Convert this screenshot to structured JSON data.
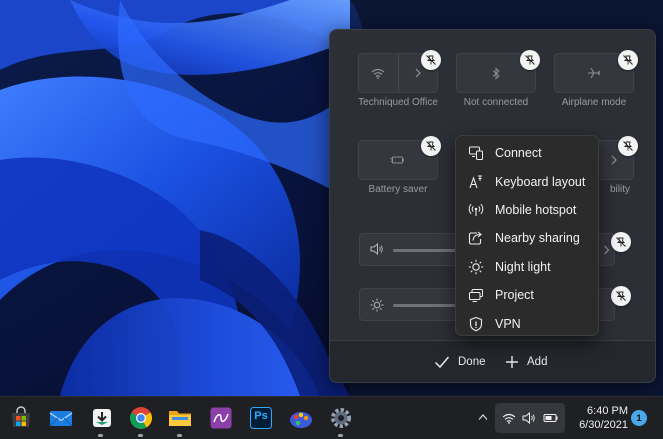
{
  "quick_settings": {
    "tiles": [
      {
        "label": "Techniqued Office",
        "icon": "wifi-icon",
        "split": true
      },
      {
        "label": "Not connected",
        "icon": "bluetooth-icon",
        "split": false
      },
      {
        "label": "Airplane mode",
        "icon": "airplane-icon",
        "split": false
      },
      {
        "label": "Battery saver",
        "icon": "battery-saver-icon",
        "split": false
      },
      {
        "label": "bility",
        "icon": "accessibility-icon",
        "split": true
      }
    ],
    "sliders": [
      {
        "icon": "volume-icon"
      },
      {
        "icon": "brightness-icon"
      }
    ],
    "footer": {
      "done_label": "Done",
      "add_label": "Add"
    }
  },
  "add_menu": {
    "items": [
      {
        "label": "Connect",
        "icon": "connect-icon"
      },
      {
        "label": "Keyboard layout",
        "icon": "keyboard-layout-icon"
      },
      {
        "label": "Mobile hotspot",
        "icon": "mobile-hotspot-icon"
      },
      {
        "label": "Nearby sharing",
        "icon": "nearby-sharing-icon"
      },
      {
        "label": "Night light",
        "icon": "night-light-icon"
      },
      {
        "label": "Project",
        "icon": "project-icon"
      },
      {
        "label": "VPN",
        "icon": "vpn-icon"
      }
    ]
  },
  "taskbar": {
    "apps": [
      {
        "name": "Microsoft Store",
        "icon": "store-icon"
      },
      {
        "name": "Mail",
        "icon": "mail-icon"
      },
      {
        "name": "Download manager",
        "icon": "download-app-icon"
      },
      {
        "name": "Chrome",
        "icon": "chrome-icon"
      },
      {
        "name": "File Explorer",
        "icon": "folder-icon"
      },
      {
        "name": "Affinity",
        "icon": "affinity-icon"
      },
      {
        "name": "Photoshop",
        "icon": "photoshop-icon",
        "text": "Ps"
      },
      {
        "name": "Paint app",
        "icon": "paint-icon"
      },
      {
        "name": "Settings",
        "icon": "settings-gear-icon"
      }
    ],
    "clock": {
      "time": "6:40 PM",
      "date": "6/30/2021"
    },
    "notification_count": "1",
    "colors": {
      "accent": "#4aa8ea",
      "taskbar": "#1f2023",
      "panel": "#2c2f36"
    }
  }
}
